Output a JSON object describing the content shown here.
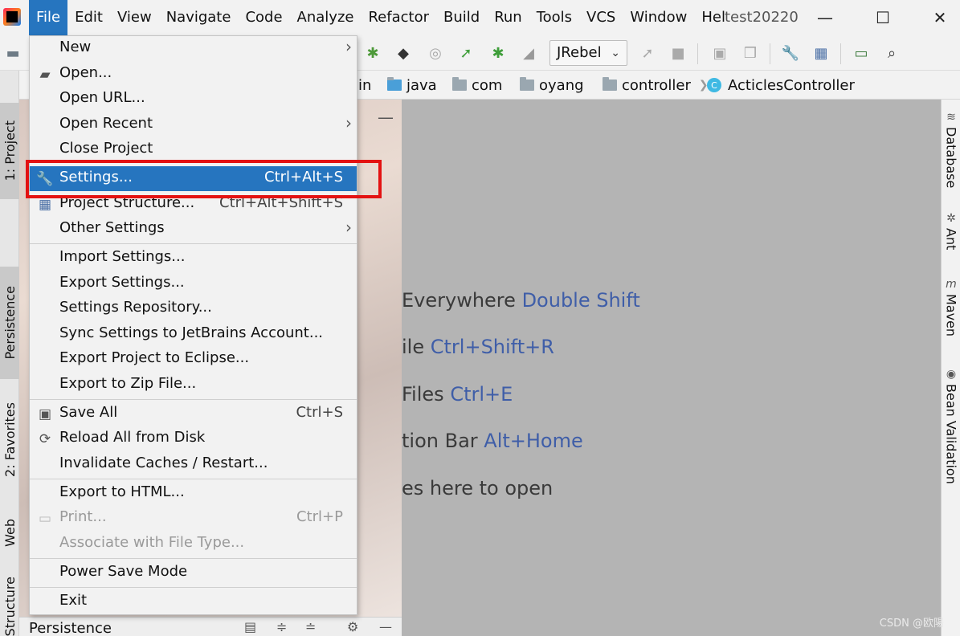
{
  "menubar": {
    "items": [
      "File",
      "Edit",
      "View",
      "Navigate",
      "Code",
      "Analyze",
      "Refactor",
      "Build",
      "Run",
      "Tools",
      "VCS",
      "Window",
      "Hel"
    ],
    "window_title": "test20220"
  },
  "toolbar": {
    "run_config": "JRebel"
  },
  "breadcrumb": [
    "in",
    "java",
    "com",
    "oyang",
    "controller",
    "ActiclesController"
  ],
  "left_tabs": [
    "1: Project",
    "Persistence",
    "2: Favorites",
    "Web",
    "Structure"
  ],
  "right_tabs": [
    "Database",
    "Ant",
    "Maven",
    "Bean Validation"
  ],
  "bottom_panel": {
    "title": "Persistence"
  },
  "editor_hints": [
    {
      "text": "Everywhere",
      "shortcut": "Double Shift"
    },
    {
      "text": "ile",
      "shortcut": "Ctrl+Shift+R"
    },
    {
      "text": "Files",
      "shortcut": "Ctrl+E"
    },
    {
      "text": "tion Bar",
      "shortcut": "Alt+Home"
    },
    {
      "text": "es here to open",
      "shortcut": ""
    }
  ],
  "file_menu": {
    "items": [
      {
        "label": "New",
        "shortcut": "",
        "submenu": true
      },
      {
        "label": "Open...",
        "shortcut": ""
      },
      {
        "label": "Open URL...",
        "shortcut": ""
      },
      {
        "label": "Open Recent",
        "shortcut": "",
        "submenu": true
      },
      {
        "label": "Close Project",
        "shortcut": ""
      },
      {
        "label": "Settings...",
        "shortcut": "Ctrl+Alt+S",
        "highlighted": true
      },
      {
        "label": "Project Structure...",
        "shortcut": "Ctrl+Alt+Shift+S"
      },
      {
        "label": "Other Settings",
        "shortcut": "",
        "submenu": true
      },
      {
        "label": "Import Settings...",
        "shortcut": ""
      },
      {
        "label": "Export Settings...",
        "shortcut": ""
      },
      {
        "label": "Settings Repository...",
        "shortcut": ""
      },
      {
        "label": "Sync Settings to JetBrains Account...",
        "shortcut": ""
      },
      {
        "label": "Export Project to Eclipse...",
        "shortcut": ""
      },
      {
        "label": "Export to Zip File...",
        "shortcut": ""
      },
      {
        "label": "Save All",
        "shortcut": "Ctrl+S"
      },
      {
        "label": "Reload All from Disk",
        "shortcut": ""
      },
      {
        "label": "Invalidate Caches / Restart...",
        "shortcut": ""
      },
      {
        "label": "Export to HTML...",
        "shortcut": ""
      },
      {
        "label": "Print...",
        "shortcut": "Ctrl+P",
        "disabled": true
      },
      {
        "label": "Associate with File Type...",
        "shortcut": "",
        "disabled": true
      },
      {
        "label": "Power Save Mode",
        "shortcut": ""
      },
      {
        "label": "Exit",
        "shortcut": ""
      }
    ]
  },
  "watermark": "CSDN @欧陽",
  "colors": {
    "highlight": "#2675bf",
    "annotation": "#e31212",
    "shortcut_text": "#3f5ea8"
  }
}
